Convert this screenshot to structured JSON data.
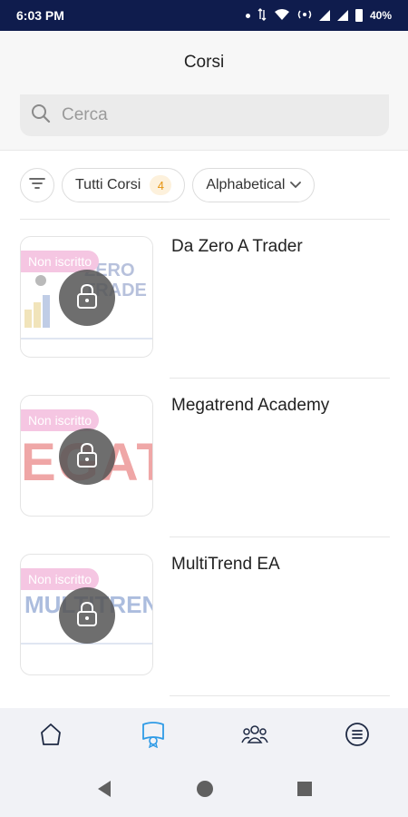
{
  "status_bar": {
    "time": "6:03 PM",
    "battery": "40%"
  },
  "header": {
    "title": "Corsi"
  },
  "search": {
    "placeholder": "Cerca"
  },
  "filters": {
    "all_label": "Tutti Corsi",
    "all_count": "4",
    "sort_label": "Alphabetical"
  },
  "courses": [
    {
      "title": "Da Zero A Trader",
      "status": "Non iscritto",
      "thumb_text": "ZERO TRADE"
    },
    {
      "title": "Megatrend Academy",
      "status": "Non iscritto",
      "thumb_text": "EGAT"
    },
    {
      "title": "MultiTrend EA",
      "status": "Non iscritto",
      "thumb_text": "MULTITREN"
    }
  ],
  "nav": {
    "items": [
      {
        "icon": "home-icon",
        "active": false
      },
      {
        "icon": "courses-icon",
        "active": true
      },
      {
        "icon": "community-icon",
        "active": false
      },
      {
        "icon": "menu-icon",
        "active": false
      }
    ],
    "accent": "#2f9be6",
    "inactive": "#1f2a44"
  },
  "colors": {
    "status_bar": "#0f1c4d",
    "tag": "#f5c6e2",
    "badge_text": "#e6930f"
  }
}
